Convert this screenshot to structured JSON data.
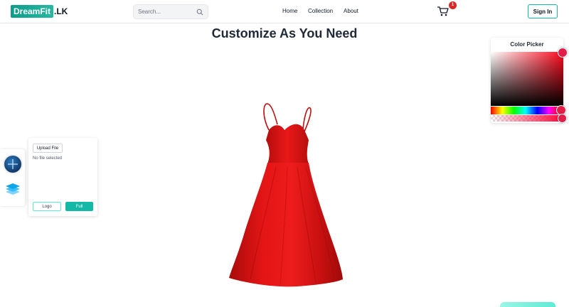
{
  "header": {
    "logo_main": "DreamFit",
    "logo_suffix": ".LK",
    "search_placeholder": "Search...",
    "nav": [
      "Home",
      "Collection",
      "About"
    ],
    "cart_count": "1",
    "signin_label": "Sign In"
  },
  "main": {
    "title": "Customize As You Need"
  },
  "upload": {
    "button_label": "Upload File",
    "status": "No file selected",
    "logo_label": "Logo",
    "full_label": "Full"
  },
  "color_picker": {
    "title": "Color Picker",
    "selected_color": "#e11d48"
  },
  "colors": {
    "accent": "#14b8a6",
    "dress": "#e01010",
    "badge": "#dc2626"
  }
}
